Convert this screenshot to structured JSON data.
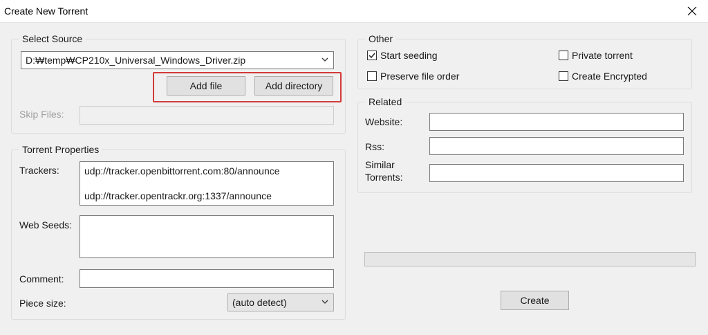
{
  "window": {
    "title": "Create New Torrent"
  },
  "source": {
    "group_title": "Select Source",
    "path": "D:₩temp₩CP210x_Universal_Windows_Driver.zip",
    "add_file_label": "Add file",
    "add_directory_label": "Add directory",
    "skip_files_label": "Skip Files:"
  },
  "properties": {
    "group_title": "Torrent Properties",
    "trackers_label": "Trackers:",
    "trackers": [
      "udp://tracker.openbittorrent.com:80/announce",
      "udp://tracker.opentrackr.org:1337/announce"
    ],
    "web_seeds_label": "Web Seeds:",
    "comment_label": "Comment:",
    "piece_size_label": "Piece size:",
    "piece_size_value": "(auto detect)"
  },
  "other": {
    "group_title": "Other",
    "start_seeding": {
      "label": "Start seeding",
      "checked": true
    },
    "private_torrent": {
      "label": "Private torrent",
      "checked": false
    },
    "preserve_file_order": {
      "label": "Preserve file order",
      "checked": false
    },
    "create_encrypted": {
      "label": "Create Encrypted",
      "checked": false
    }
  },
  "related": {
    "group_title": "Related",
    "website_label": "Website:",
    "rss_label": "Rss:",
    "similar_label_line1": "Similar",
    "similar_label_line2": "Torrents:"
  },
  "actions": {
    "create_label": "Create"
  },
  "icons": {
    "close": "close-icon",
    "chevron": "chevron-down-icon",
    "check": "checkmark-icon"
  },
  "colors": {
    "highlight": "#d23a3a"
  }
}
